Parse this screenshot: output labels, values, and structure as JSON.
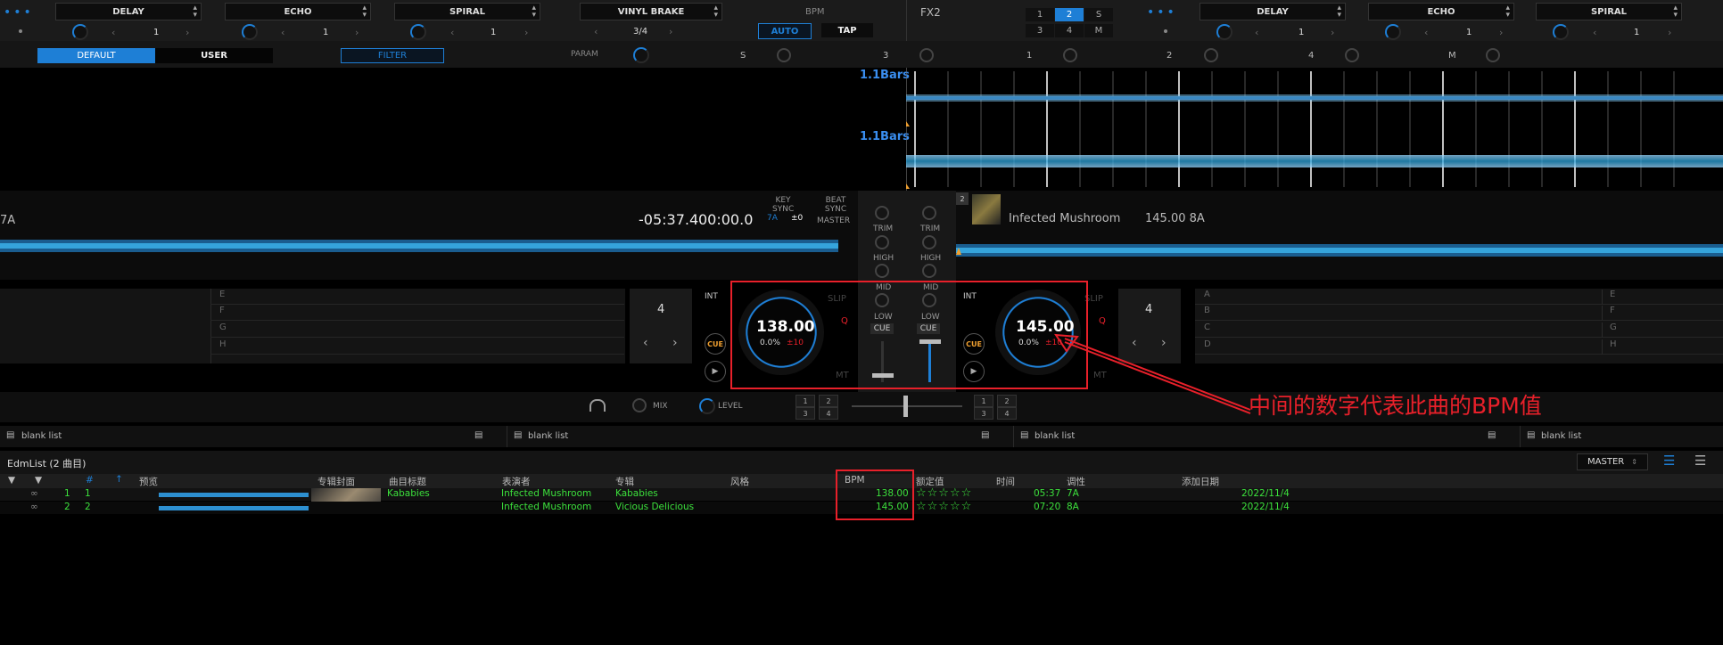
{
  "fx_left": {
    "slot1": "DELAY",
    "slot2": "ECHO",
    "slot3": "SPIRAL",
    "v1": "1",
    "v2": "1",
    "v3": "1"
  },
  "fx_right": {
    "slot1": "DELAY",
    "slot2": "ECHO",
    "slot3": "SPIRAL",
    "v1": "1",
    "v2": "1",
    "v3": "1"
  },
  "sampler": {
    "effect": "VINYL BRAKE",
    "beat": "3/4"
  },
  "bpm_panel": {
    "label": "BPM",
    "auto": "AUTO",
    "tap": "TAP"
  },
  "fx2": {
    "label": "FX2",
    "deck_buttons": [
      "1",
      "2",
      "S",
      "3",
      "4",
      "M"
    ]
  },
  "tabs": {
    "default": "DEFAULT",
    "user": "USER",
    "filter": "FILTER",
    "param": "PARAM",
    "s": "S",
    "n3": "3",
    "n1": "1",
    "n2": "2",
    "n4": "4",
    "m": "M"
  },
  "waveform": {
    "bars_top": "1.1Bars",
    "bars_bottom": "1.1Bars"
  },
  "deck1": {
    "key_prefix": "7A",
    "time_remaining": "-05:37.4",
    "time_elapsed": "00:00.0",
    "bpm": "138.00",
    "pitch": "0.0%",
    "pitch_range": "±10",
    "key_sync": "KEY SYNC",
    "key": "7A",
    "key_offset": "±0",
    "beat_sync": "BEAT SYNC",
    "master": "MASTER",
    "int": "INT",
    "slip": "SLIP",
    "q": "Q",
    "mt": "MT",
    "cue": "CUE",
    "loop": "4",
    "pads": [
      "E",
      "F",
      "G",
      "H"
    ]
  },
  "deck2": {
    "number": "2",
    "artist": "Infected Mushroom",
    "info": "145.00 8A",
    "bpm": "145.00",
    "pitch": "0.0%",
    "pitch_range": "±10",
    "int": "INT",
    "slip": "SLIP",
    "q": "Q",
    "mt": "MT",
    "cue": "CUE",
    "loop": "4",
    "pads_a": [
      "A",
      "B",
      "C",
      "D"
    ],
    "pads_e": [
      "E",
      "F",
      "G",
      "H"
    ]
  },
  "mixer": {
    "trim": "TRIM",
    "high": "HIGH",
    "mid": "MID",
    "low": "LOW",
    "cue": "CUE",
    "mix": "MIX",
    "level": "LEVEL",
    "ch_buttons": [
      "1",
      "2",
      "3",
      "4"
    ]
  },
  "annotation": {
    "text": "中间的数字代表此曲的BPM值"
  },
  "blank_lists": [
    "blank list",
    "blank list",
    "blank list",
    "blank list"
  ],
  "library": {
    "title": "EdmList (2 曲目)",
    "master": "MASTER",
    "columns": {
      "num": "#",
      "preview": "预览",
      "art": "专辑封面",
      "title": "曲目标题",
      "artist": "表演者",
      "album": "专辑",
      "genre": "风格",
      "bpm": "BPM",
      "rating": "额定值",
      "time": "时间",
      "key": "调性",
      "date": "添加日期"
    },
    "rows": [
      {
        "idx": "1",
        "num": "1",
        "title": "Kababies",
        "artist": "Infected Mushroom",
        "album": "Kababies",
        "bpm": "138.00",
        "rating": "☆☆☆☆☆",
        "time": "05:37",
        "key": "7A",
        "date": "2022/11/4"
      },
      {
        "idx": "2",
        "num": "2",
        "title": "",
        "artist": "Infected Mushroom",
        "album": "Vicious Delicious",
        "bpm": "145.00",
        "rating": "☆☆☆☆☆",
        "time": "07:20",
        "key": "8A",
        "date": "2022/11/4"
      }
    ]
  },
  "colors": {
    "accent": "#1e7fd6",
    "highlight": "#e8202a",
    "track_text": "#3ce03c"
  }
}
